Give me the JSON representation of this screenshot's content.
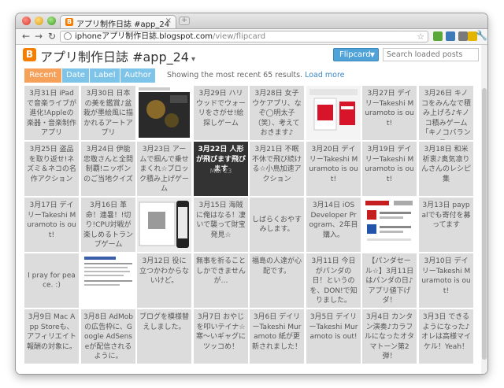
{
  "browser": {
    "tab_title": "アプリ制作日誌 #app_24",
    "tab_favicon": "B",
    "url_host": "iphoneアプリ制作日誌.blogspot.com",
    "url_path": "/view/flipcard"
  },
  "blog": {
    "title": "アプリ制作日誌 #app_24",
    "view_button": "Flipcard",
    "search_placeholder": "Search loaded posts",
    "sort_tabs": [
      "Recent",
      "Date",
      "Label",
      "Author"
    ],
    "results_text": "Showing the most recent 65 results.",
    "load_more": "Load more"
  },
  "posts": [
    {
      "text": "3月31日 iPadで音楽ライブが進化!Appleの楽器・音楽制作アプリ",
      "kind": "text"
    },
    {
      "text": "3月30日 日本の美を鑑賞♪盆栽が墨絵風に描かれるアートアプリ",
      "kind": "text"
    },
    {
      "text": "",
      "kind": "img-dark"
    },
    {
      "text": "3月29日 ハリウッドでウォーリをさがせ!絵探しゲーム",
      "kind": "text"
    },
    {
      "text": "3月28日 女子ウケアプリ、なぞ◯明太子（笑）、考えておきます♪",
      "kind": "text"
    },
    {
      "text": "",
      "kind": "img-red"
    },
    {
      "text": "3月27日 デイリーTakeshi Muramoto is out!",
      "kind": "text"
    },
    {
      "text": "3月26日 キノコをみんなで積み上げろ♪キノコ積みゲーム「キノコバランス」",
      "kind": "text"
    },
    {
      "text": "3月25日 盗品を取り返せ!ネズミ＆ネコの名作アクション",
      "kind": "text"
    },
    {
      "text": "3月24日 伊能忠敬さんと全問制覇!ニッポンのご当地クイズ",
      "kind": "text"
    },
    {
      "text": "3月23日 アームで掴んで乗せまくれ☆ブロック積み上げゲーム",
      "kind": "text"
    },
    {
      "text": "3月22日 人形が飛びます飛びます",
      "kind": "dark",
      "sub": "Mar 23"
    },
    {
      "text": "3月21日 不眠不休で飛び続ける☆小鳥加速アクション",
      "kind": "text"
    },
    {
      "text": "3月20日 デイリーTakeshi Muramoto is out!",
      "kind": "text"
    },
    {
      "text": "3月19日 デイリーTakeshi Muramoto is out!",
      "kind": "text"
    },
    {
      "text": "3月18日 和米祈衷♪奥気凛りんさんのレシピ集",
      "kind": "text"
    },
    {
      "text": "3月17日 デイリーTakeshi Muramoto is out!",
      "kind": "text"
    },
    {
      "text": "3月16日 革命！連暑！!切り!CPU対戦が楽しめるトランプゲーム",
      "kind": "text"
    },
    {
      "text": "",
      "kind": "img-screen"
    },
    {
      "text": "3月15日 海賊に俺はなる！凄いで襲って財宝発見☆",
      "kind": "text"
    },
    {
      "text": "しばらくおやすみします。",
      "kind": "center"
    },
    {
      "text": "3月14日 iOS Developer Program、2年目購入。",
      "kind": "text"
    },
    {
      "text": "",
      "kind": "img-news"
    },
    {
      "text": "3月13日 paypalでも寄付を募ってます",
      "kind": "text"
    },
    {
      "text": "I pray for peace. :)",
      "kind": "center"
    },
    {
      "text": "",
      "kind": "img-doc"
    },
    {
      "text": "3月12日 役に立つかわからないけど。",
      "kind": "text"
    },
    {
      "text": "無事を祈ることしかできませんが…",
      "kind": "text"
    },
    {
      "text": "福島の人達が心配です。",
      "kind": "text"
    },
    {
      "text": "3月11日 今日がパンダの日！というのを、DON!で知りました。",
      "kind": "text"
    },
    {
      "text": "【パンダセール☆】3月11日はパンダの日♪アプリ値下げダ！",
      "kind": "text"
    },
    {
      "text": "3月10日 デイリーTakeshi Muramoto is out!",
      "kind": "text"
    },
    {
      "text": "3月9日 Mac App Storeも、アフィリエイト報酬の対象に。",
      "kind": "text"
    },
    {
      "text": "3月8日 AdMobの広告枠に、Google AdSenseが配信されるように。",
      "kind": "text"
    },
    {
      "text": "ブログを模様替えしました。",
      "kind": "text"
    },
    {
      "text": "3月7日 おやじを叩いテイナ☆寒〜いギャグにツッコめ！",
      "kind": "text"
    },
    {
      "text": "3月6日 デイリーTakeshi Muramoto 紙が更新されました！",
      "kind": "text"
    },
    {
      "text": "3月5日 デイリーTakeshi Muramoto is out!",
      "kind": "text"
    },
    {
      "text": "3月4日 カンタン演奏♪カラフルになったオタマトーン第2弾！",
      "kind": "text"
    },
    {
      "text": "3月3日 できるようになった♪オレは高様マイケル！Yeah！",
      "kind": "text"
    }
  ],
  "colors": {
    "tab_active": "#f5a15a",
    "tab_inactive": "#7ec4e8",
    "flipcard_button": "#4fa3d8",
    "cell_bg": "#dcdcdc",
    "cell_text": "#555555"
  }
}
